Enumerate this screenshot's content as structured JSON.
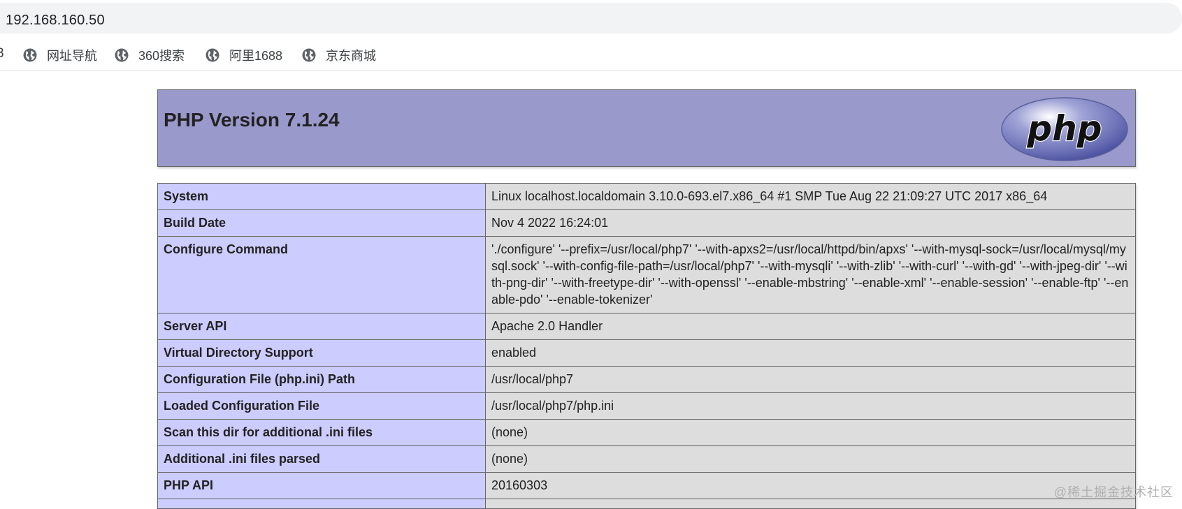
{
  "browser": {
    "address": "192.168.160.50",
    "bookmark_cut_label": "3",
    "bookmarks": [
      {
        "label": "网址导航",
        "icon": "globe-icon"
      },
      {
        "label": "360搜索",
        "icon": "globe-icon"
      },
      {
        "label": "阿里1688",
        "icon": "globe-icon"
      },
      {
        "label": "京东商城",
        "icon": "globe-icon"
      }
    ]
  },
  "phpinfo": {
    "title": "PHP Version 7.1.24",
    "logo_text": "php",
    "colors": {
      "header_bg": "#9999cc",
      "label_bg": "#ccccff",
      "value_bg": "#dddddd",
      "border": "#666666"
    },
    "rows": [
      {
        "label": "System",
        "value": "Linux localhost.localdomain 3.10.0-693.el7.x86_64 #1 SMP Tue Aug 22 21:09:27 UTC 2017 x86_64"
      },
      {
        "label": "Build Date",
        "value": "Nov 4 2022 16:24:01"
      },
      {
        "label": "Configure Command",
        "value": "'./configure' '--prefix=/usr/local/php7' '--with-apxs2=/usr/local/httpd/bin/apxs' '--with-mysql-sock=/usr/local/mysql/mysql.sock' '--with-config-file-path=/usr/local/php7' '--with-mysqli' '--with-zlib' '--with-curl' '--with-gd' '--with-jpeg-dir' '--with-png-dir' '--with-freetype-dir' '--with-openssl' '--enable-mbstring' '--enable-xml' '--enable-session' '--enable-ftp' '--enable-pdo' '--enable-tokenizer'"
      },
      {
        "label": "Server API",
        "value": "Apache 2.0 Handler"
      },
      {
        "label": "Virtual Directory Support",
        "value": "enabled"
      },
      {
        "label": "Configuration File (php.ini) Path",
        "value": "/usr/local/php7"
      },
      {
        "label": "Loaded Configuration File",
        "value": "/usr/local/php7/php.ini"
      },
      {
        "label": "Scan this dir for additional .ini files",
        "value": "(none)"
      },
      {
        "label": "Additional .ini files parsed",
        "value": "(none)"
      },
      {
        "label": "PHP API",
        "value": "20160303"
      },
      {
        "label": "",
        "value": ""
      }
    ]
  },
  "watermark": "@稀土掘金技术社区"
}
